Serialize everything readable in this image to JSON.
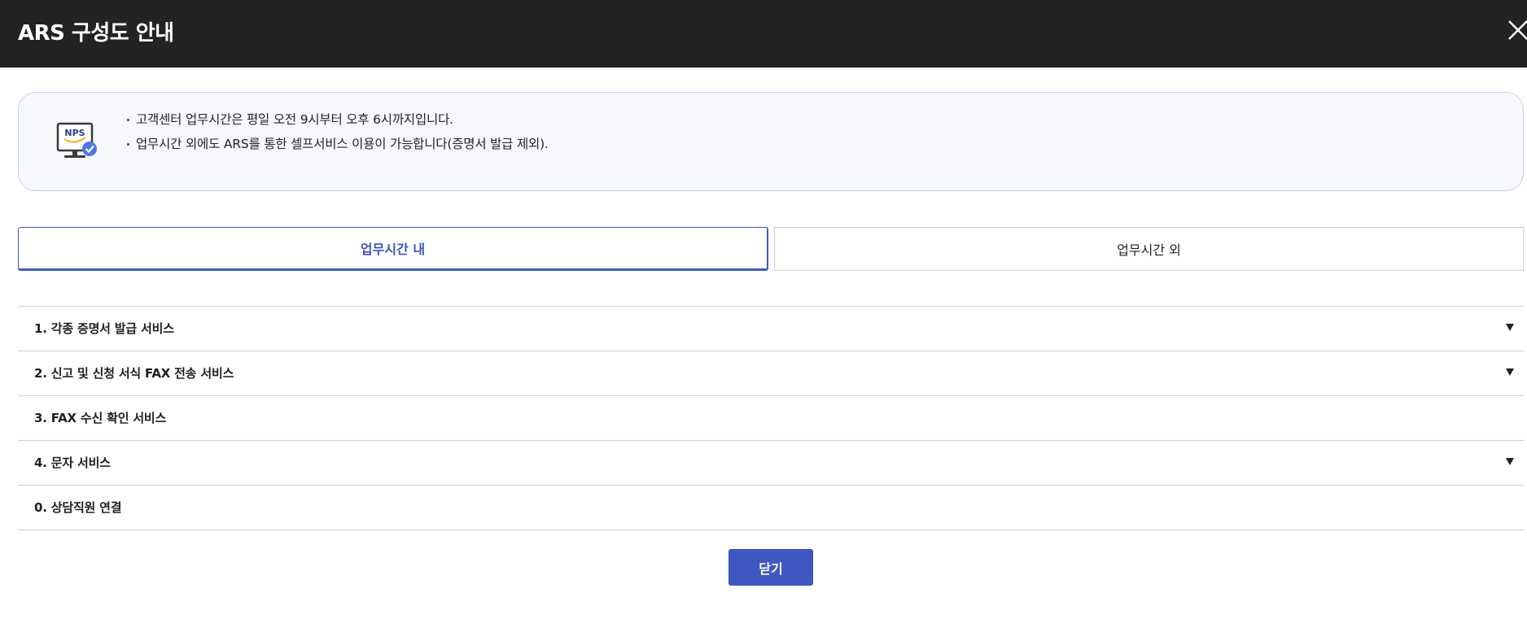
{
  "header": {
    "title": "ARS 구성도 안내",
    "close_icon": "close-icon"
  },
  "notice": {
    "icon": "nps-monitor-check-icon",
    "icon_text": "NPS",
    "lines": [
      "고객센터 업무시간은 평일 오전 9시부터 오후 6시까지입니다.",
      "업무시간 외에도 ARS를 통한 셀프서비스 이용이 가능합니다(증명서 발급 제외)."
    ]
  },
  "tabs": [
    {
      "label": "업무시간 내",
      "active": true
    },
    {
      "label": "업무시간 외",
      "active": false
    }
  ],
  "menu": [
    {
      "label": "1. 각종 증명서 발급 서비스",
      "expandable": true
    },
    {
      "label": "2. 신고 및 신청 서식 FAX 전송 서비스",
      "expandable": true
    },
    {
      "label": "3. FAX 수신 확인 서비스",
      "expandable": false
    },
    {
      "label": "4. 문자 서비스",
      "expandable": true
    },
    {
      "label": "0. 상담직원 연결",
      "expandable": false
    }
  ],
  "footer": {
    "close_button_label": "닫기"
  },
  "colors": {
    "header_bg": "#232323",
    "accent": "#3f57c0",
    "notice_bg": "#f6f8fb",
    "notice_border": "#c7d0e6",
    "divider": "#cfcfcf"
  }
}
